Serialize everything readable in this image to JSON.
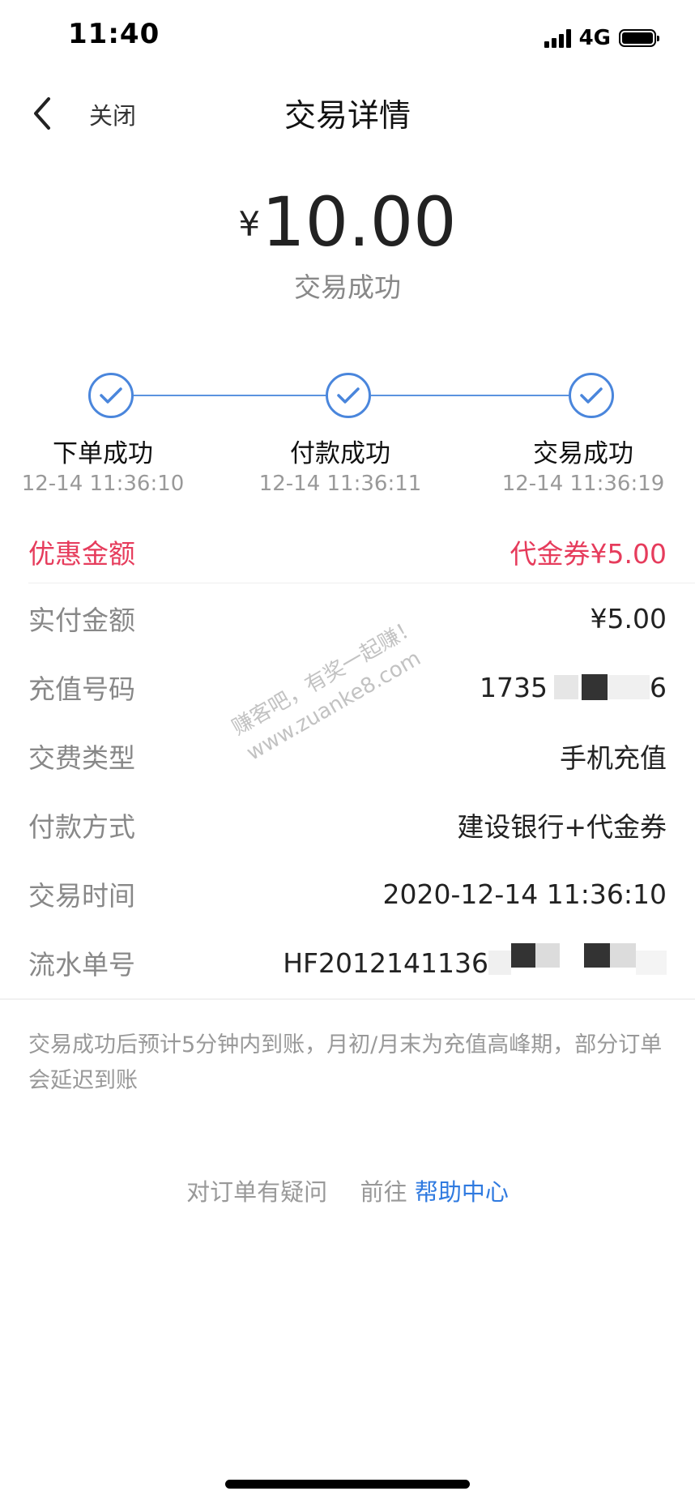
{
  "status_bar": {
    "time": "11:40",
    "network": "4G"
  },
  "nav": {
    "back_icon": "chevron-left-icon",
    "close_label": "关闭",
    "title": "交易详情"
  },
  "summary": {
    "currency": "¥",
    "amount": "10.00",
    "status": "交易成功"
  },
  "steps": [
    {
      "label": "下单成功",
      "time": "12-14 11:36:10",
      "icon": "check-circle-icon"
    },
    {
      "label": "付款成功",
      "time": "12-14 11:36:11",
      "icon": "check-circle-icon"
    },
    {
      "label": "交易成功",
      "time": "12-14 11:36:19",
      "icon": "check-circle-icon"
    }
  ],
  "details": {
    "discount": {
      "label": "优惠金额",
      "value": "代金券¥5.00"
    },
    "paid": {
      "label": "实付金额",
      "value": "¥5.00"
    },
    "phone": {
      "label": "充值号码",
      "value_prefix": "1735",
      "value_suffix": "6"
    },
    "type": {
      "label": "交费类型",
      "value": "手机充值"
    },
    "payment": {
      "label": "付款方式",
      "value": "建设银行+代金券"
    },
    "time": {
      "label": "交易时间",
      "value": "2020-12-14 11:36:10"
    },
    "serial": {
      "label": "流水单号",
      "value_prefix": "HF2012141136"
    }
  },
  "watermark": {
    "line1": "赚客吧，有奖一起赚！",
    "line2": "www.zuanke8.com"
  },
  "notice": "交易成功后预计5分钟内到账，月初/月末为充值高峰期，部分订单会延迟到账",
  "help": {
    "question": "对订单有疑问",
    "goto": "前往",
    "link": "帮助中心"
  },
  "colors": {
    "accent_blue": "#4a86dc",
    "discount_red": "#e63c5c",
    "link_blue": "#2f7ae0"
  }
}
